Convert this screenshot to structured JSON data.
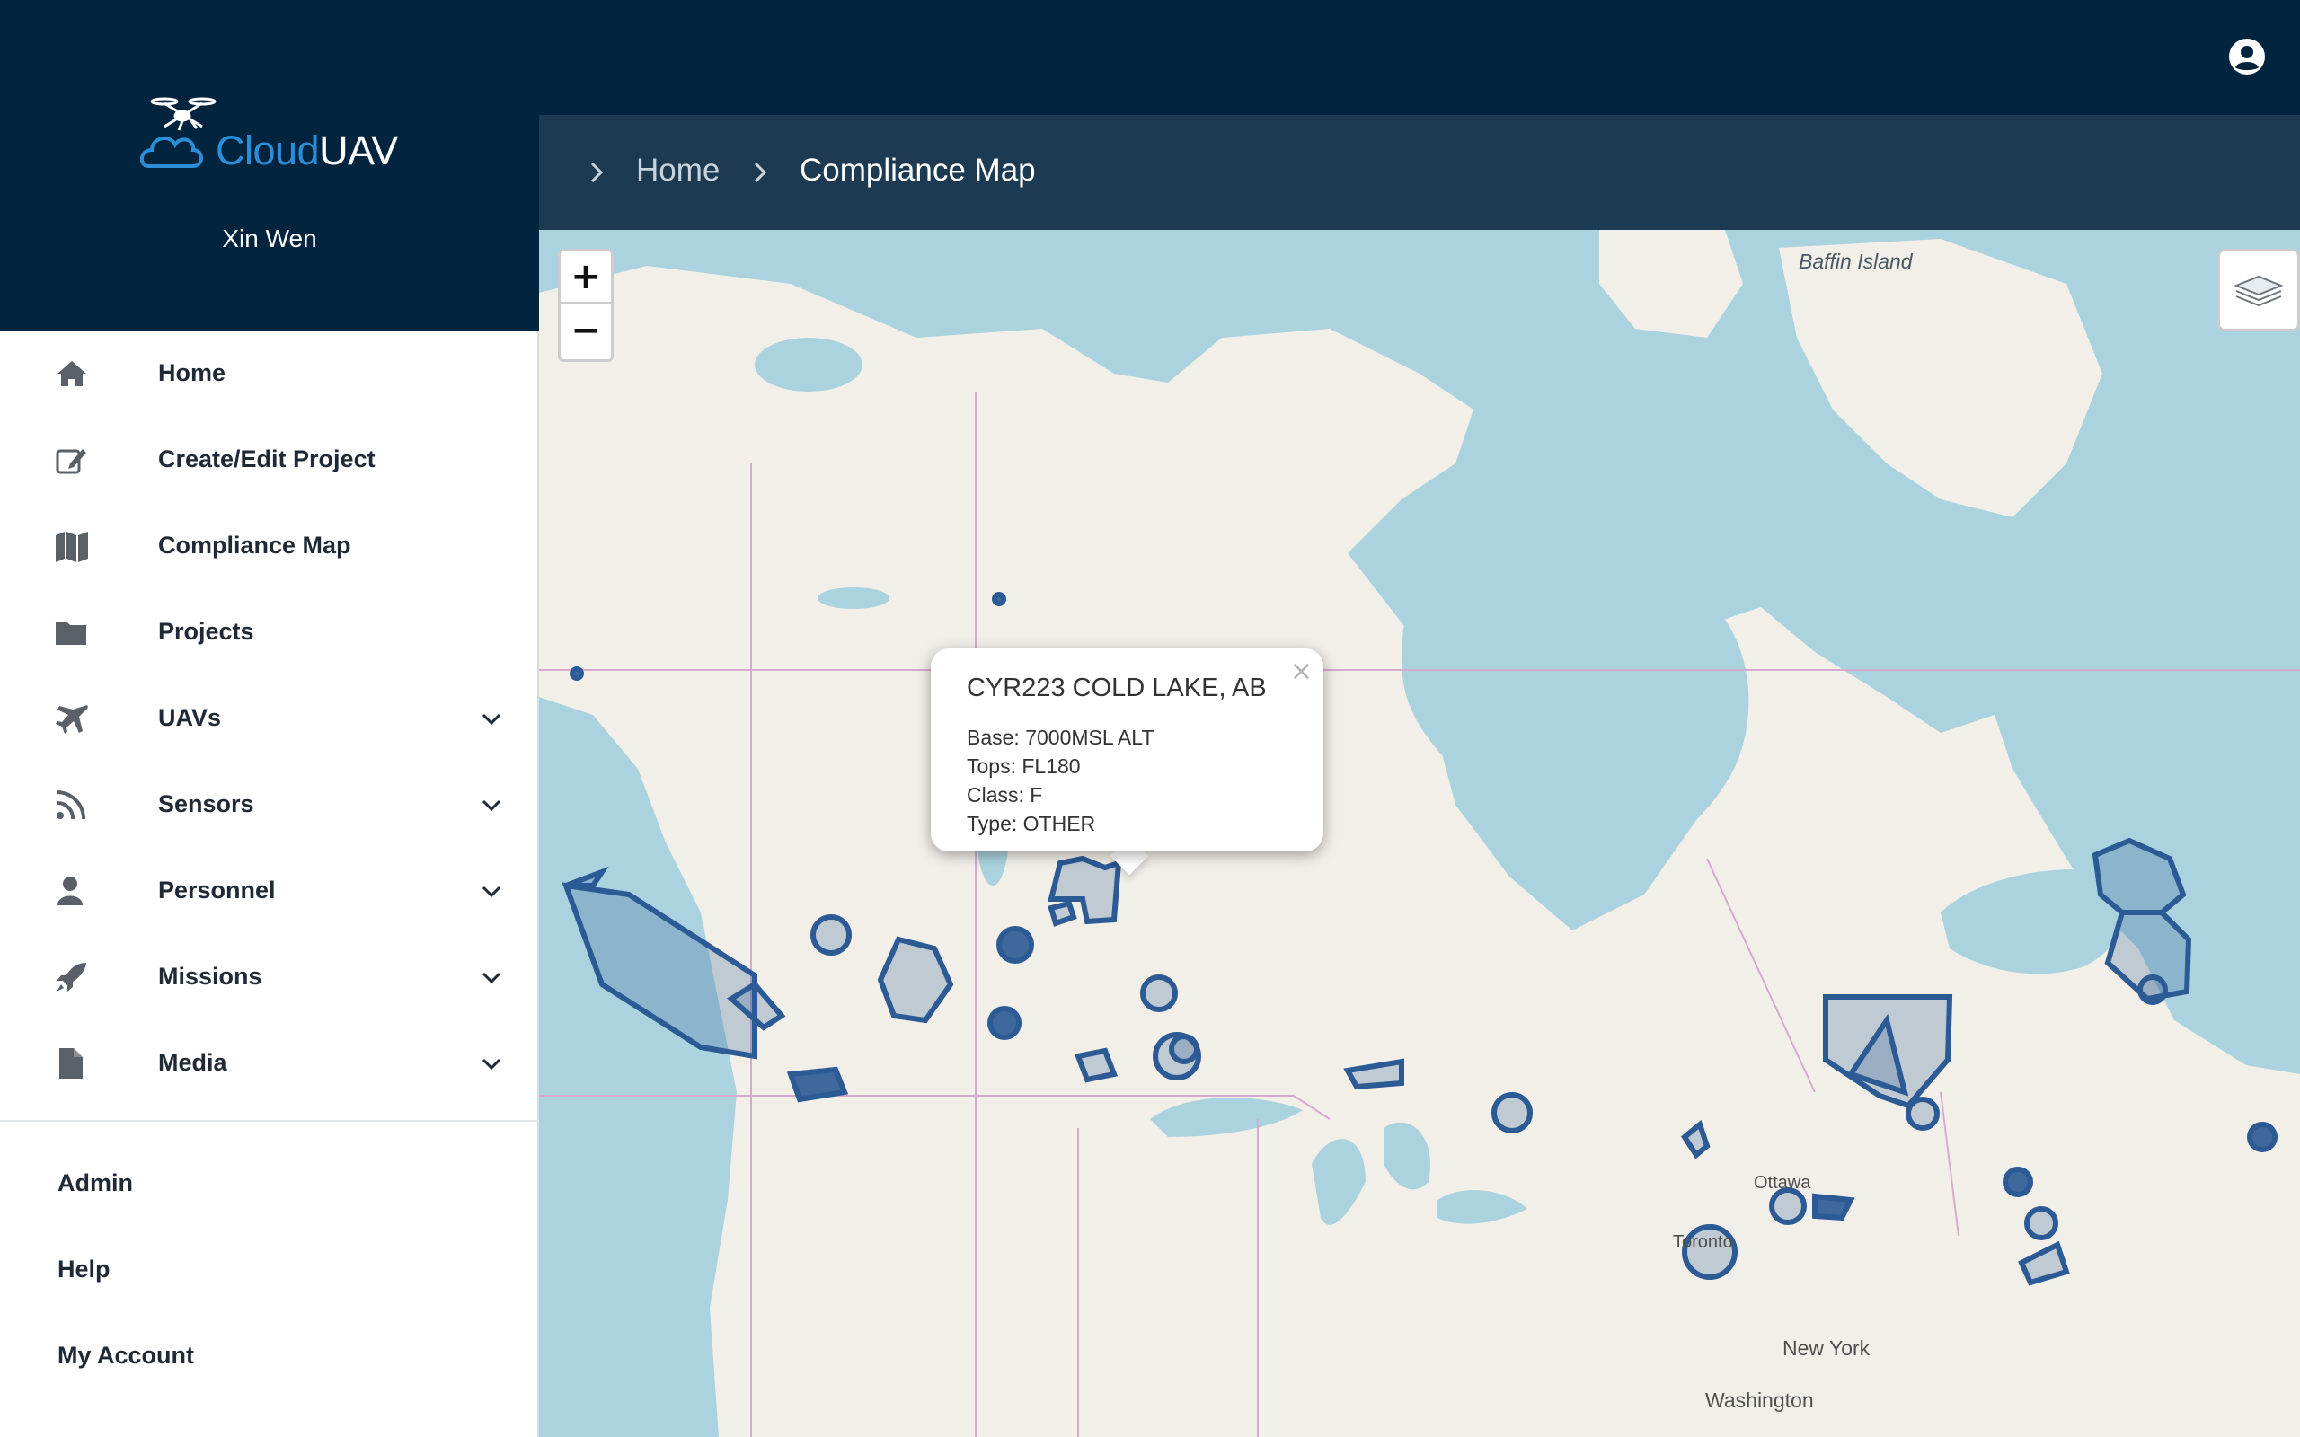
{
  "app": {
    "brand_cloud": "Cloud",
    "brand_uav": "UAV",
    "user_name": "Xin Wen"
  },
  "sidebar": {
    "items": [
      {
        "label": "Home",
        "icon": "home-icon"
      },
      {
        "label": "Create/Edit Project",
        "icon": "edit-icon"
      },
      {
        "label": "Compliance Map",
        "icon": "map-icon"
      },
      {
        "label": "Projects",
        "icon": "folder-icon"
      },
      {
        "label": "UAVs",
        "icon": "plane-icon",
        "expandable": true
      },
      {
        "label": "Sensors",
        "icon": "rss-icon",
        "expandable": true
      },
      {
        "label": "Personnel",
        "icon": "user-icon",
        "expandable": true
      },
      {
        "label": "Missions",
        "icon": "rocket-icon",
        "expandable": true
      },
      {
        "label": "Media",
        "icon": "file-icon",
        "expandable": true
      }
    ],
    "secondary": [
      {
        "label": "Admin"
      },
      {
        "label": "Help"
      },
      {
        "label": "My Account"
      }
    ]
  },
  "breadcrumb": {
    "items": [
      "Home",
      "Compliance Map"
    ]
  },
  "map": {
    "zoom_in": "+",
    "zoom_out": "−",
    "labels": {
      "baffin": "Baffin Island",
      "ottawa": "Ottawa",
      "toronto": "Toronto",
      "new_york": "New York",
      "washington": "Washington"
    },
    "popup": {
      "title": "CYR223 COLD LAKE, AB",
      "close": "×",
      "lines": [
        "Base: 7000MSL ALT",
        "Tops: FL180",
        "Class: F",
        "Type: OTHER"
      ]
    }
  },
  "colors": {
    "header": "#03243e",
    "breadcrumb_bar": "#1c3a52",
    "water": "#abd3df",
    "land": "#f2efe9",
    "zone_stroke": "#2b5a94"
  }
}
